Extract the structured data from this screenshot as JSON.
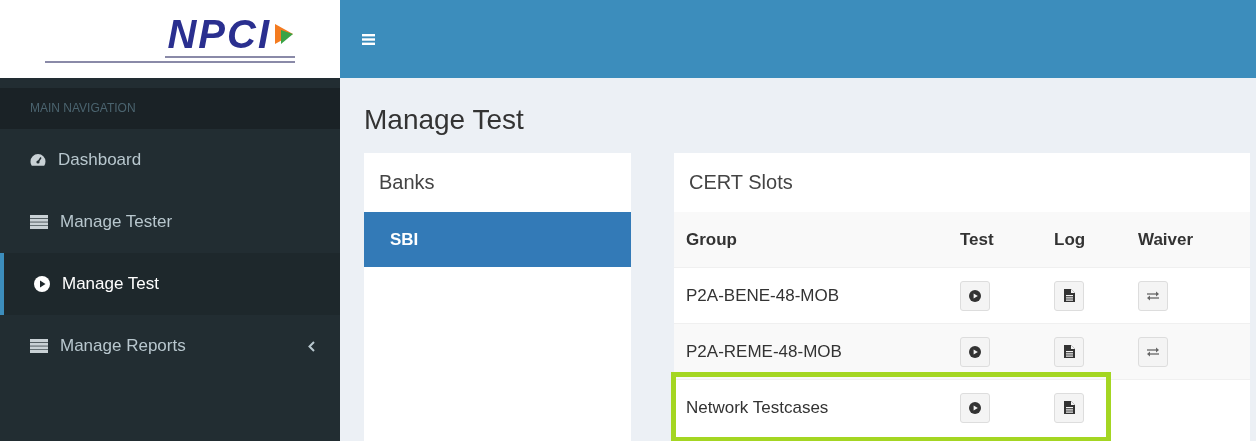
{
  "logo": {
    "text": "NPCI"
  },
  "sidebar": {
    "heading": "MAIN NAVIGATION",
    "items": [
      {
        "label": "Dashboard",
        "kind": "dashboard",
        "selected": false,
        "expandable": false
      },
      {
        "label": "Manage Tester",
        "kind": "list",
        "selected": false,
        "expandable": false
      },
      {
        "label": "Manage Test",
        "kind": "play",
        "selected": true,
        "expandable": false
      },
      {
        "label": "Manage Reports",
        "kind": "list",
        "selected": false,
        "expandable": true
      }
    ]
  },
  "page_title": "Manage Test",
  "banks": {
    "title": "Banks",
    "items": [
      {
        "label": "SBI",
        "selected": true
      }
    ]
  },
  "cert_slots": {
    "title": "CERT Slots",
    "columns": [
      "Group",
      "Test",
      "Log",
      "Waiver"
    ],
    "rows": [
      {
        "group": "P2A-BENE-48-MOB",
        "waiver": true,
        "highlighted": false
      },
      {
        "group": "P2A-REME-48-MOB",
        "waiver": true,
        "highlighted": false
      },
      {
        "group": "Network Testcases",
        "waiver": false,
        "highlighted": true
      }
    ]
  }
}
